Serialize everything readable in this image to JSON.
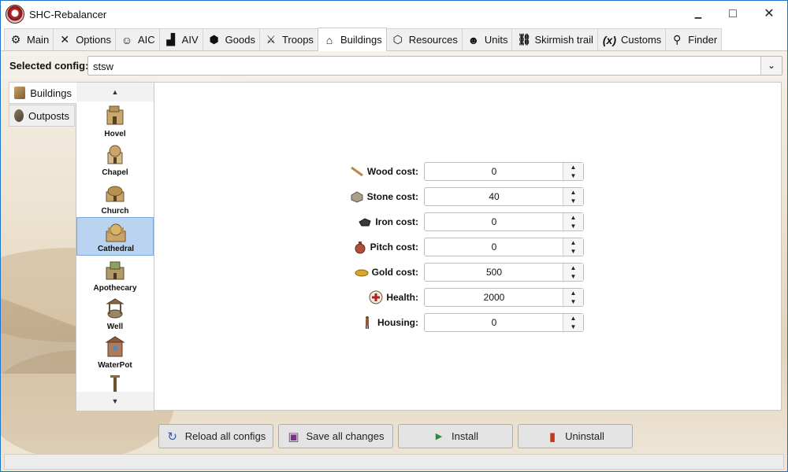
{
  "window": {
    "title": "SHC-Rebalancer",
    "controls": {
      "minimize": "▁",
      "maximize": "□",
      "close": "✕"
    }
  },
  "tabs": [
    {
      "label": "Main",
      "icon": "gear-icon",
      "glyph": "⚙"
    },
    {
      "label": "Options",
      "icon": "tools-icon",
      "glyph": "✕"
    },
    {
      "label": "AIC",
      "icon": "robot-icon",
      "glyph": "☺"
    },
    {
      "label": "AIV",
      "icon": "factory-icon",
      "glyph": "▟"
    },
    {
      "label": "Goods",
      "icon": "box-icon",
      "glyph": "⬢"
    },
    {
      "label": "Troops",
      "icon": "swords-icon",
      "glyph": "⚔"
    },
    {
      "label": "Buildings",
      "icon": "warehouse-icon",
      "glyph": "⌂",
      "active": true
    },
    {
      "label": "Resources",
      "icon": "cube-icon",
      "glyph": "⬡"
    },
    {
      "label": "Units",
      "icon": "people-icon",
      "glyph": "☻"
    },
    {
      "label": "Skirmish trail",
      "icon": "trail-icon",
      "glyph": "⛓"
    },
    {
      "label": "Customs",
      "icon": "variable-icon",
      "glyph": "(x)"
    },
    {
      "label": "Finder",
      "icon": "search-icon",
      "glyph": "⚲"
    }
  ],
  "config": {
    "label": "Selected config:",
    "value": "stsw",
    "arrow": "⌄"
  },
  "side_tabs": [
    {
      "label": "Buildings",
      "active": true
    },
    {
      "label": "Outposts",
      "active": false
    }
  ],
  "building_list": {
    "scroll_up": "▲",
    "scroll_down": "▼",
    "items": [
      {
        "label": "Hovel"
      },
      {
        "label": "Chapel"
      },
      {
        "label": "Church"
      },
      {
        "label": "Cathedral",
        "selected": true
      },
      {
        "label": "Apothecary"
      },
      {
        "label": "Well"
      },
      {
        "label": "WaterPot"
      }
    ]
  },
  "fields": [
    {
      "label": "Wood cost:",
      "value": "0",
      "icon": "wood-icon"
    },
    {
      "label": "Stone cost:",
      "value": "40",
      "icon": "stone-icon"
    },
    {
      "label": "Iron cost:",
      "value": "0",
      "icon": "iron-icon"
    },
    {
      "label": "Pitch cost:",
      "value": "0",
      "icon": "pitch-icon"
    },
    {
      "label": "Gold cost:",
      "value": "500",
      "icon": "gold-icon"
    },
    {
      "label": "Health:",
      "value": "2000",
      "icon": "health-icon"
    },
    {
      "label": "Housing:",
      "value": "0",
      "icon": "housing-icon"
    }
  ],
  "spinner": {
    "up": "▲",
    "down": "▼"
  },
  "buttons": {
    "reload": {
      "label": "Reload all configs",
      "icon": "refresh-icon",
      "glyph": "↻",
      "color": "#2a5fb0"
    },
    "save": {
      "label": "Save all changes",
      "icon": "save-icon",
      "glyph": "▣",
      "color": "#7a2f8a"
    },
    "install": {
      "label": "Install",
      "icon": "play-icon",
      "glyph": "▶",
      "color": "#2e8b3a"
    },
    "uninstall": {
      "label": "Uninstall",
      "icon": "trash-icon",
      "glyph": "▮",
      "color": "#c0391e"
    }
  },
  "colors": {
    "accent_border": "#1e73c8",
    "selection": "#b9d3f0"
  }
}
